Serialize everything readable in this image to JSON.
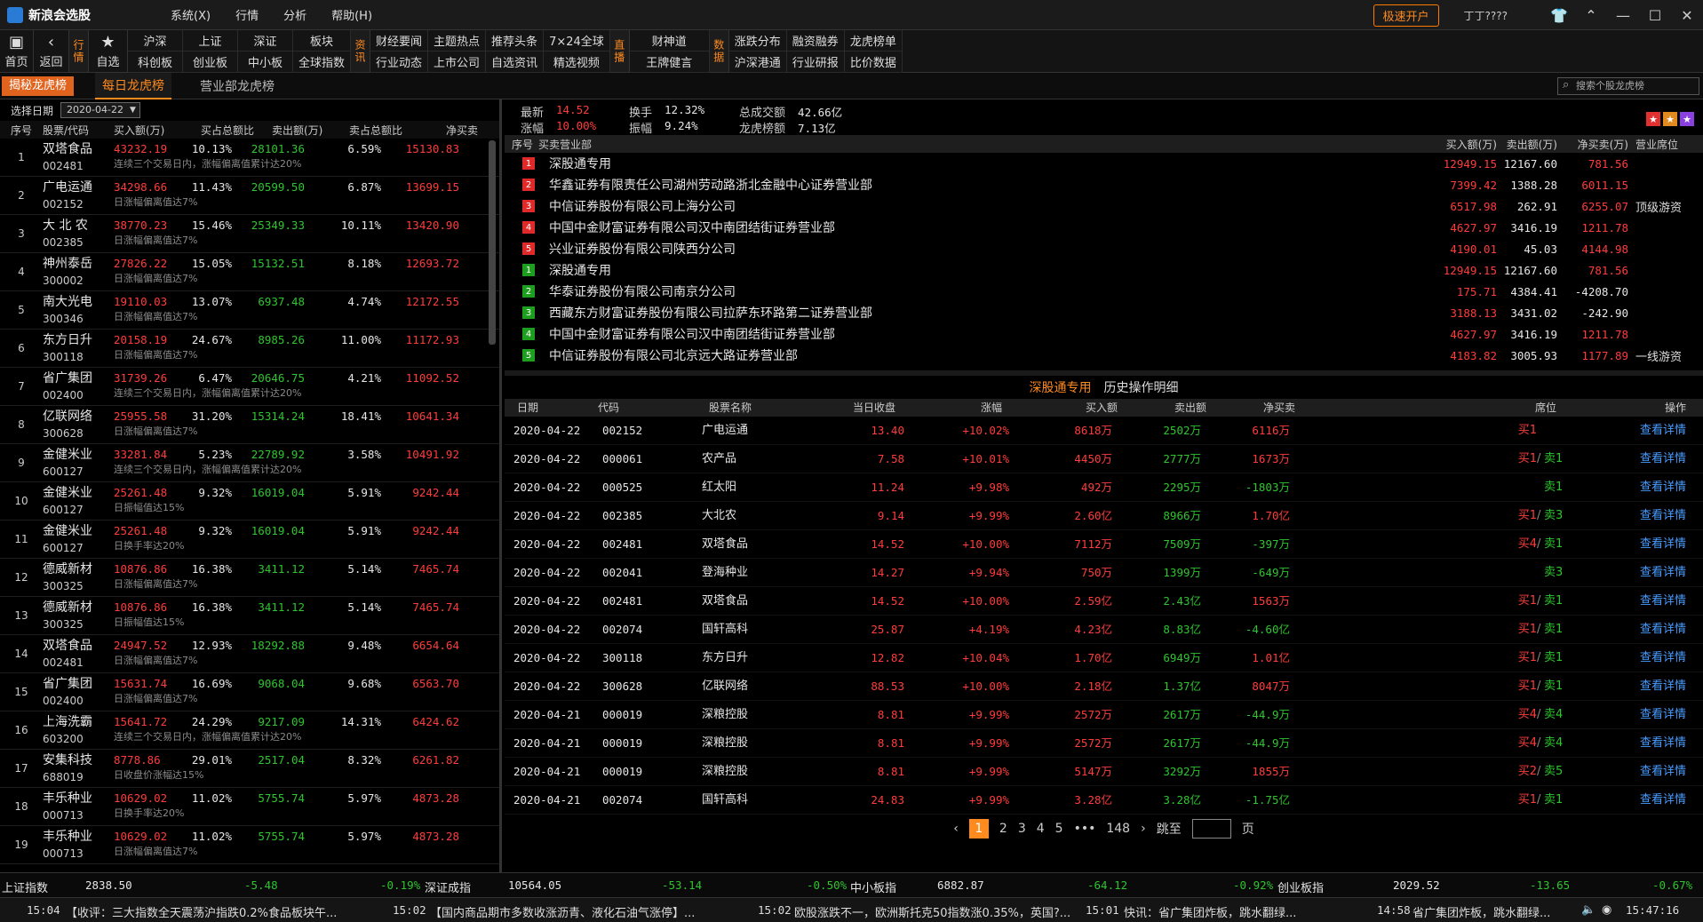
{
  "app": {
    "title": "新浪会选股",
    "menus": [
      "系统(X)",
      "行情",
      "分析",
      "帮助(H)"
    ],
    "open_account": "极速开户",
    "user": "丁丁????"
  },
  "toolbar": {
    "home": "首页",
    "back": "返回",
    "tag_market": "行情",
    "favorites": "自选",
    "group1": [
      "沪深",
      "科创板",
      "上证",
      "创业板",
      "深证",
      "中小板",
      "板块",
      "全球指数"
    ],
    "tag_news": "资讯",
    "group2": [
      "财经要闻",
      "行业动态",
      "主题热点",
      "上市公司",
      "推荐头条",
      "自选资讯",
      "7×24全球",
      "精选视频"
    ],
    "tag_live": "直播",
    "group3": [
      "财神道",
      "王牌健言"
    ],
    "tag_data": "数据",
    "group4": [
      "涨跌分布",
      "沪深港通",
      "融资融券",
      "行业研报",
      "龙虎榜单",
      "比价数据"
    ]
  },
  "tabs": {
    "brand": "揭秘龙虎榜",
    "daily": "每日龙虎榜",
    "dept": "营业部龙虎榜",
    "search_placeholder": "搜索个股龙虎榜"
  },
  "left": {
    "date_label": "选择日期",
    "date_value": "2020-04-22",
    "headers": [
      "序号",
      "股票/代码",
      "买入额(万)",
      "买占总额比",
      "卖出额(万)",
      "卖占总额比",
      "净买卖"
    ],
    "rows": [
      {
        "no": "1",
        "name": "双塔食品",
        "code": "002481",
        "buy": "43232.19",
        "buy_pct": "10.13%",
        "sell": "28101.36",
        "sell_pct": "6.59%",
        "net": "15130.83",
        "note": "连续三个交易日内，涨幅偏离值累计达20%"
      },
      {
        "no": "2",
        "name": "广电运通",
        "code": "002152",
        "buy": "34298.66",
        "buy_pct": "11.43%",
        "sell": "20599.50",
        "sell_pct": "6.87%",
        "net": "13699.15",
        "note": "日涨幅偏离值达7%"
      },
      {
        "no": "3",
        "name": "大 北 农",
        "code": "002385",
        "buy": "38770.23",
        "buy_pct": "15.46%",
        "sell": "25349.33",
        "sell_pct": "10.11%",
        "net": "13420.90",
        "note": "日涨幅偏离值达7%"
      },
      {
        "no": "4",
        "name": "神州泰岳",
        "code": "300002",
        "buy": "27826.22",
        "buy_pct": "15.05%",
        "sell": "15132.51",
        "sell_pct": "8.18%",
        "net": "12693.72",
        "note": "日涨幅偏离值达7%"
      },
      {
        "no": "5",
        "name": "南大光电",
        "code": "300346",
        "buy": "19110.03",
        "buy_pct": "13.07%",
        "sell": "6937.48",
        "sell_pct": "4.74%",
        "net": "12172.55",
        "note": "日涨幅偏离值达7%"
      },
      {
        "no": "6",
        "name": "东方日升",
        "code": "300118",
        "buy": "20158.19",
        "buy_pct": "24.67%",
        "sell": "8985.26",
        "sell_pct": "11.00%",
        "net": "11172.93",
        "note": "日涨幅偏离值达7%"
      },
      {
        "no": "7",
        "name": "省广集团",
        "code": "002400",
        "buy": "31739.26",
        "buy_pct": "6.47%",
        "sell": "20646.75",
        "sell_pct": "4.21%",
        "net": "11092.52",
        "note": "连续三个交易日内，涨幅偏离值累计达20%"
      },
      {
        "no": "8",
        "name": "亿联网络",
        "code": "300628",
        "buy": "25955.58",
        "buy_pct": "31.20%",
        "sell": "15314.24",
        "sell_pct": "18.41%",
        "net": "10641.34",
        "note": "日涨幅偏离值达7%"
      },
      {
        "no": "9",
        "name": "金健米业",
        "code": "600127",
        "buy": "33281.84",
        "buy_pct": "5.23%",
        "sell": "22789.92",
        "sell_pct": "3.58%",
        "net": "10491.92",
        "note": "连续三个交易日内，涨幅偏离值累计达20%"
      },
      {
        "no": "10",
        "name": "金健米业",
        "code": "600127",
        "buy": "25261.48",
        "buy_pct": "9.32%",
        "sell": "16019.04",
        "sell_pct": "5.91%",
        "net": "9242.44",
        "note": "日振幅值达15%"
      },
      {
        "no": "11",
        "name": "金健米业",
        "code": "600127",
        "buy": "25261.48",
        "buy_pct": "9.32%",
        "sell": "16019.04",
        "sell_pct": "5.91%",
        "net": "9242.44",
        "note": "日换手率达20%"
      },
      {
        "no": "12",
        "name": "德威新材",
        "code": "300325",
        "buy": "10876.86",
        "buy_pct": "16.38%",
        "sell": "3411.12",
        "sell_pct": "5.14%",
        "net": "7465.74",
        "note": "日涨幅偏离值达7%"
      },
      {
        "no": "13",
        "name": "德威新材",
        "code": "300325",
        "buy": "10876.86",
        "buy_pct": "16.38%",
        "sell": "3411.12",
        "sell_pct": "5.14%",
        "net": "7465.74",
        "note": "日振幅值达15%"
      },
      {
        "no": "14",
        "name": "双塔食品",
        "code": "002481",
        "buy": "24947.52",
        "buy_pct": "12.93%",
        "sell": "18292.88",
        "sell_pct": "9.48%",
        "net": "6654.64",
        "note": "日涨幅偏离值达7%"
      },
      {
        "no": "15",
        "name": "省广集团",
        "code": "002400",
        "buy": "15631.74",
        "buy_pct": "16.69%",
        "sell": "9068.04",
        "sell_pct": "9.68%",
        "net": "6563.70",
        "note": "日涨幅偏离值达7%"
      },
      {
        "no": "16",
        "name": "上海洗霸",
        "code": "603200",
        "buy": "15641.72",
        "buy_pct": "24.29%",
        "sell": "9217.09",
        "sell_pct": "14.31%",
        "net": "6424.62",
        "note": "连续三个交易日内，涨幅偏离值累计达20%"
      },
      {
        "no": "17",
        "name": "安集科技",
        "code": "688019",
        "buy": "8778.86",
        "buy_pct": "29.01%",
        "sell": "2517.04",
        "sell_pct": "8.32%",
        "net": "6261.82",
        "note": "日收盘价涨幅达15%"
      },
      {
        "no": "18",
        "name": "丰乐种业",
        "code": "000713",
        "buy": "10629.02",
        "buy_pct": "11.02%",
        "sell": "5755.74",
        "sell_pct": "5.97%",
        "net": "4873.28",
        "note": "日换手率达20%"
      },
      {
        "no": "19",
        "name": "丰乐种业",
        "code": "000713",
        "buy": "10629.02",
        "buy_pct": "11.02%",
        "sell": "5755.74",
        "sell_pct": "5.97%",
        "net": "4873.28",
        "note": "日涨幅偏离值达7%"
      }
    ]
  },
  "stats": {
    "latest_label": "最新",
    "latest": "14.52",
    "turnover_label": "换手",
    "turnover": "12.32%",
    "total_label": "总成交额",
    "total": "42.66亿",
    "change_label": "涨幅",
    "change": "10.00%",
    "amp_label": "振幅",
    "amp": "9.24%",
    "lhb_label": "龙虎榜额",
    "lhb": "7.13亿"
  },
  "brokers": {
    "headers": [
      "序号",
      "买卖营业部",
      "买入额(万)",
      "卖出额(万)",
      "净买卖(万)",
      "营业席位"
    ],
    "rows": [
      {
        "rank": "1",
        "side": "buy",
        "name": "深股通专用",
        "buy": "12949.15",
        "sell": "12167.60",
        "net": "781.56",
        "seat": ""
      },
      {
        "rank": "2",
        "side": "buy",
        "name": "华鑫证券有限责任公司湖州劳动路浙北金融中心证券营业部",
        "buy": "7399.42",
        "sell": "1388.28",
        "net": "6011.15",
        "seat": ""
      },
      {
        "rank": "3",
        "side": "buy",
        "name": "中信证券股份有限公司上海分公司",
        "buy": "6517.98",
        "sell": "262.91",
        "net": "6255.07",
        "seat": "顶级游资"
      },
      {
        "rank": "4",
        "side": "buy",
        "name": "中国中金财富证券有限公司汉中南团结街证券营业部",
        "buy": "4627.97",
        "sell": "3416.19",
        "net": "1211.78",
        "seat": ""
      },
      {
        "rank": "5",
        "side": "buy",
        "name": "兴业证券股份有限公司陕西分公司",
        "buy": "4190.01",
        "sell": "45.03",
        "net": "4144.98",
        "seat": ""
      },
      {
        "rank": "1",
        "side": "sell",
        "name": "深股通专用",
        "buy": "12949.15",
        "sell": "12167.60",
        "net": "781.56",
        "seat": ""
      },
      {
        "rank": "2",
        "side": "sell",
        "name": "华泰证券股份有限公司南京分公司",
        "buy": "175.71",
        "sell": "4384.41",
        "net": "-4208.70",
        "seat": ""
      },
      {
        "rank": "3",
        "side": "sell",
        "name": "西藏东方财富证券股份有限公司拉萨东环路第二证券营业部",
        "buy": "3188.13",
        "sell": "3431.02",
        "net": "-242.90",
        "seat": ""
      },
      {
        "rank": "4",
        "side": "sell",
        "name": "中国中金财富证券有限公司汉中南团结街证券营业部",
        "buy": "4627.97",
        "sell": "3416.19",
        "net": "1211.78",
        "seat": ""
      },
      {
        "rank": "5",
        "side": "sell",
        "name": "中信证券股份有限公司北京远大路证券营业部",
        "buy": "4183.82",
        "sell": "3005.93",
        "net": "1177.89",
        "seat": "一线游资"
      }
    ]
  },
  "detail": {
    "tabs": [
      "深股通专用",
      "历史操作明细"
    ],
    "headers": [
      "日期",
      "代码",
      "股票名称",
      "当日收盘",
      "涨幅",
      "买入额",
      "卖出额",
      "净买卖",
      "席位",
      "操作"
    ],
    "rows": [
      {
        "date": "2020-04-22",
        "code": "002152",
        "name": "广电运通",
        "close": "13.40",
        "chg": "+10.02%",
        "buy": "8618万",
        "sell": "2502万",
        "net": "6116万",
        "seat_b": "买1",
        "seat_s": "",
        "op": "查看详情"
      },
      {
        "date": "2020-04-22",
        "code": "000061",
        "name": "农产品",
        "close": "7.58",
        "chg": "+10.01%",
        "buy": "4450万",
        "sell": "2777万",
        "net": "1673万",
        "seat_b": "买1",
        "seat_s": "卖1",
        "op": "查看详情"
      },
      {
        "date": "2020-04-22",
        "code": "000525",
        "name": "红太阳",
        "close": "11.24",
        "chg": "+9.98%",
        "buy": "492万",
        "sell": "2295万",
        "net": "-1803万",
        "seat_b": "",
        "seat_s": "卖1",
        "op": "查看详情"
      },
      {
        "date": "2020-04-22",
        "code": "002385",
        "name": "大北农",
        "close": "9.14",
        "chg": "+9.99%",
        "buy": "2.60亿",
        "sell": "8966万",
        "net": "1.70亿",
        "seat_b": "买1",
        "seat_s": "卖3",
        "op": "查看详情"
      },
      {
        "date": "2020-04-22",
        "code": "002481",
        "name": "双塔食品",
        "close": "14.52",
        "chg": "+10.00%",
        "buy": "7112万",
        "sell": "7509万",
        "net": "-397万",
        "seat_b": "买4",
        "seat_s": "卖1",
        "op": "查看详情"
      },
      {
        "date": "2020-04-22",
        "code": "002041",
        "name": "登海种业",
        "close": "14.27",
        "chg": "+9.94%",
        "buy": "750万",
        "sell": "1399万",
        "net": "-649万",
        "seat_b": "",
        "seat_s": "卖3",
        "op": "查看详情"
      },
      {
        "date": "2020-04-22",
        "code": "002481",
        "name": "双塔食品",
        "close": "14.52",
        "chg": "+10.00%",
        "buy": "2.59亿",
        "sell": "2.43亿",
        "net": "1563万",
        "seat_b": "买1",
        "seat_s": "卖1",
        "op": "查看详情"
      },
      {
        "date": "2020-04-22",
        "code": "002074",
        "name": "国轩高科",
        "close": "25.87",
        "chg": "+4.19%",
        "buy": "4.23亿",
        "sell": "8.83亿",
        "net": "-4.60亿",
        "seat_b": "买1",
        "seat_s": "卖1",
        "op": "查看详情"
      },
      {
        "date": "2020-04-22",
        "code": "300118",
        "name": "东方日升",
        "close": "12.82",
        "chg": "+10.04%",
        "buy": "1.70亿",
        "sell": "6949万",
        "net": "1.01亿",
        "seat_b": "买1",
        "seat_s": "卖1",
        "op": "查看详情"
      },
      {
        "date": "2020-04-22",
        "code": "300628",
        "name": "亿联网络",
        "close": "88.53",
        "chg": "+10.00%",
        "buy": "2.18亿",
        "sell": "1.37亿",
        "net": "8047万",
        "seat_b": "买1",
        "seat_s": "卖1",
        "op": "查看详情"
      },
      {
        "date": "2020-04-21",
        "code": "000019",
        "name": "深粮控股",
        "close": "8.81",
        "chg": "+9.99%",
        "buy": "2572万",
        "sell": "2617万",
        "net": "-44.9万",
        "seat_b": "买4",
        "seat_s": "卖4",
        "op": "查看详情"
      },
      {
        "date": "2020-04-21",
        "code": "000019",
        "name": "深粮控股",
        "close": "8.81",
        "chg": "+9.99%",
        "buy": "2572万",
        "sell": "2617万",
        "net": "-44.9万",
        "seat_b": "买4",
        "seat_s": "卖4",
        "op": "查看详情"
      },
      {
        "date": "2020-04-21",
        "code": "000019",
        "name": "深粮控股",
        "close": "8.81",
        "chg": "+9.99%",
        "buy": "5147万",
        "sell": "3292万",
        "net": "1855万",
        "seat_b": "买2",
        "seat_s": "卖5",
        "op": "查看详情"
      },
      {
        "date": "2020-04-21",
        "code": "002074",
        "name": "国轩高科",
        "close": "24.83",
        "chg": "+9.99%",
        "buy": "3.28亿",
        "sell": "3.28亿",
        "net": "-1.75亿",
        "seat_b": "买1",
        "seat_s": "卖1",
        "op": "查看详情"
      }
    ]
  },
  "pager": {
    "pages": [
      "1",
      "2",
      "3",
      "4",
      "5"
    ],
    "ellipsis": "•••",
    "last": "148",
    "jump_label": "跳至",
    "page_label": "页"
  },
  "indices": [
    {
      "name": "上证指数",
      "value": "2838.50",
      "chg": "-5.48",
      "pct": "-0.19%"
    },
    {
      "name": "深证成指",
      "value": "10564.05",
      "chg": "-53.14",
      "pct": "-0.50%"
    },
    {
      "name": "中小板指",
      "value": "6882.87",
      "chg": "-64.12",
      "pct": "-0.92%"
    },
    {
      "name": "创业板指",
      "value": "2029.52",
      "chg": "-13.65",
      "pct": "-0.67%"
    }
  ],
  "news": [
    {
      "time": "15:04",
      "text": "【收评：三大指数全天震荡沪指跌0.2%食品板块午..."
    },
    {
      "time": "15:02",
      "text": "【国内商品期市多数收涨沥青、液化石油气涨停】..."
    },
    {
      "time": "15:02",
      "text": "欧股涨跌不一，欧洲斯托克50指数涨0.35%，英国?..."
    },
    {
      "time": "15:01",
      "text": "快讯：省广集团炸板，跳水翻绿..."
    },
    {
      "time": "14:58",
      "text": "省广集团炸板，跳水翻绿..."
    }
  ],
  "clock": "15:47:16"
}
